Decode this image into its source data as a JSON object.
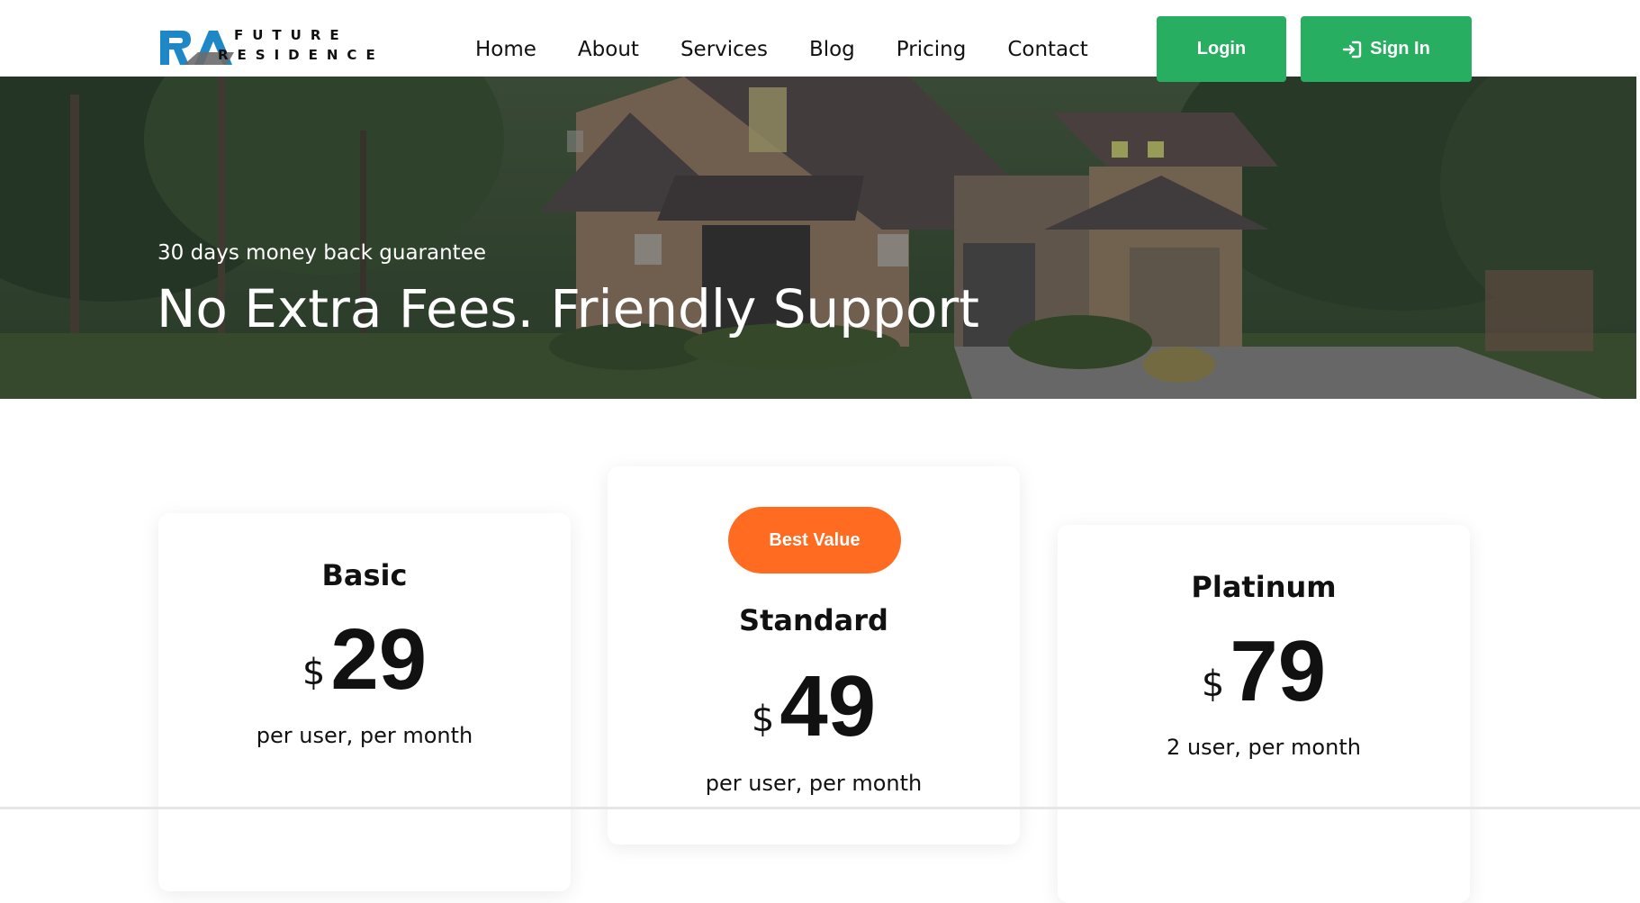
{
  "brand": {
    "line1": "FUTURE",
    "line2": "RESIDENCE",
    "colors": {
      "blue": "#1e88c7",
      "grey": "#6b6b6b",
      "dark": "#111111"
    }
  },
  "nav": {
    "items": [
      {
        "label": "Home"
      },
      {
        "label": "About"
      },
      {
        "label": "Services"
      },
      {
        "label": "Blog"
      },
      {
        "label": "Pricing"
      },
      {
        "label": "Contact"
      }
    ]
  },
  "auth": {
    "login_label": "Login",
    "signin_label": "Sign In",
    "signin_icon": "sign-in-icon",
    "color": "#27ae60"
  },
  "hero": {
    "subtitle": "30 days money back guarantee",
    "title": "No Extra Fees. Friendly Support"
  },
  "pricing": {
    "badge": {
      "label": "Best Value",
      "color": "#ff6b21"
    },
    "plans": [
      {
        "name": "Basic",
        "currency": "$",
        "amount": "29",
        "period": "per user, per month"
      },
      {
        "name": "Standard",
        "currency": "$",
        "amount": "49",
        "period": "per user, per month"
      },
      {
        "name": "Platinum",
        "currency": "$",
        "amount": "79",
        "period": "2 user, per month"
      }
    ]
  }
}
